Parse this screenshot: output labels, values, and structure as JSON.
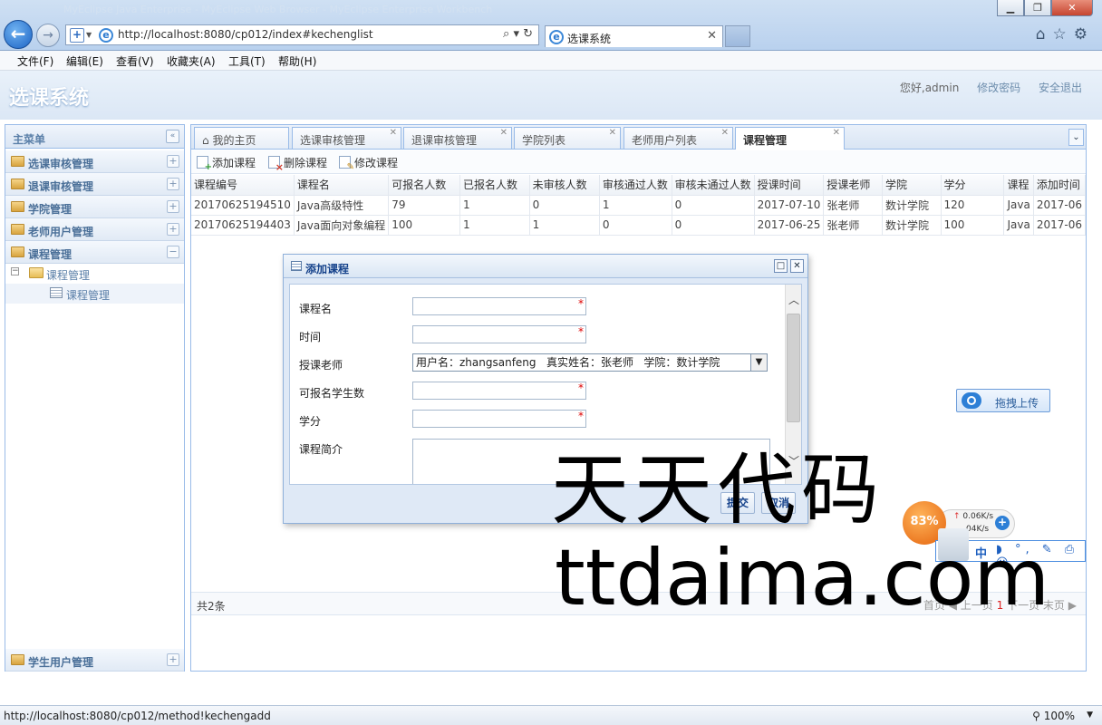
{
  "browser": {
    "window_title": "MyEclipse Java Enterprise - MyEclipse Web Browser - MyEclipse Enterprise Workbench",
    "url": "http://localhost:8080/cp012/index#kechenglist",
    "tab_title": "选课系统",
    "menu": [
      "文件(F)",
      "编辑(E)",
      "查看(V)",
      "收藏夹(A)",
      "工具(T)",
      "帮助(H)"
    ],
    "status_url": "http://localhost:8080/cp012/method!kechengadd",
    "zoom": "100%"
  },
  "app": {
    "title": "选课系统",
    "greeting": "您好,admin",
    "change_password": "修改密码",
    "logout": "安全退出"
  },
  "sidebar": {
    "title": "主菜单",
    "sections": [
      {
        "label": "选课审核管理"
      },
      {
        "label": "退课审核管理"
      },
      {
        "label": "学院管理"
      },
      {
        "label": "老师用户管理"
      },
      {
        "label": "课程管理"
      }
    ],
    "tree": {
      "folder": "课程管理",
      "leaf": "课程管理"
    },
    "bottom_section": "学生用户管理"
  },
  "tabs": [
    {
      "label": "我的主页"
    },
    {
      "label": "选课审核管理"
    },
    {
      "label": "退课审核管理"
    },
    {
      "label": "学院列表"
    },
    {
      "label": "老师用户列表"
    },
    {
      "label": "课程管理"
    }
  ],
  "toolbar": {
    "add": "添加课程",
    "delete": "删除课程",
    "edit": "修改课程"
  },
  "table": {
    "columns": [
      "课程编号",
      "课程名",
      "可报名人数",
      "已报名人数",
      "未审核人数",
      "审核通过人数",
      "审核未通过人数",
      "授课时间",
      "授课老师",
      "学院",
      "学分",
      "课程",
      "添加时间"
    ],
    "rows": [
      [
        "20170625194510",
        "Java高级特性",
        "79",
        "1",
        "0",
        "1",
        "0",
        "2017-07-10",
        "张老师",
        "数计学院",
        "120",
        "Java",
        "2017-06"
      ],
      [
        "20170625194403",
        "Java面向对象编程",
        "100",
        "1",
        "1",
        "0",
        "0",
        "2017-06-25",
        "张老师",
        "数计学院",
        "100",
        "Java",
        "2017-06"
      ]
    ]
  },
  "pager": {
    "total": "共2条",
    "first": "首页",
    "prev": "上一页",
    "current": "1",
    "next": "下一页",
    "last": "末页"
  },
  "dialog": {
    "title": "添加课程",
    "fields": {
      "name": "课程名",
      "time": "时间",
      "teacher": "授课老师",
      "capacity": "可报名学生数",
      "credit": "学分",
      "intro": "课程简介"
    },
    "required_mark": "*",
    "teacher_selected": "用户名：zhangsanfeng   真实姓名：张老师   学院：数计学院",
    "submit": "提交",
    "cancel": "取消"
  },
  "overlay": {
    "upload": "拖拽上传",
    "speed_percent": "83%",
    "up_speed": "0.06K/s",
    "down_speed": "04K/s",
    "ime_cn": "中",
    "ime_rest": "◗ °, ✎ ⎙ ☺"
  },
  "watermark": {
    "line1": "天天代码",
    "line2": "ttdaima.com"
  }
}
